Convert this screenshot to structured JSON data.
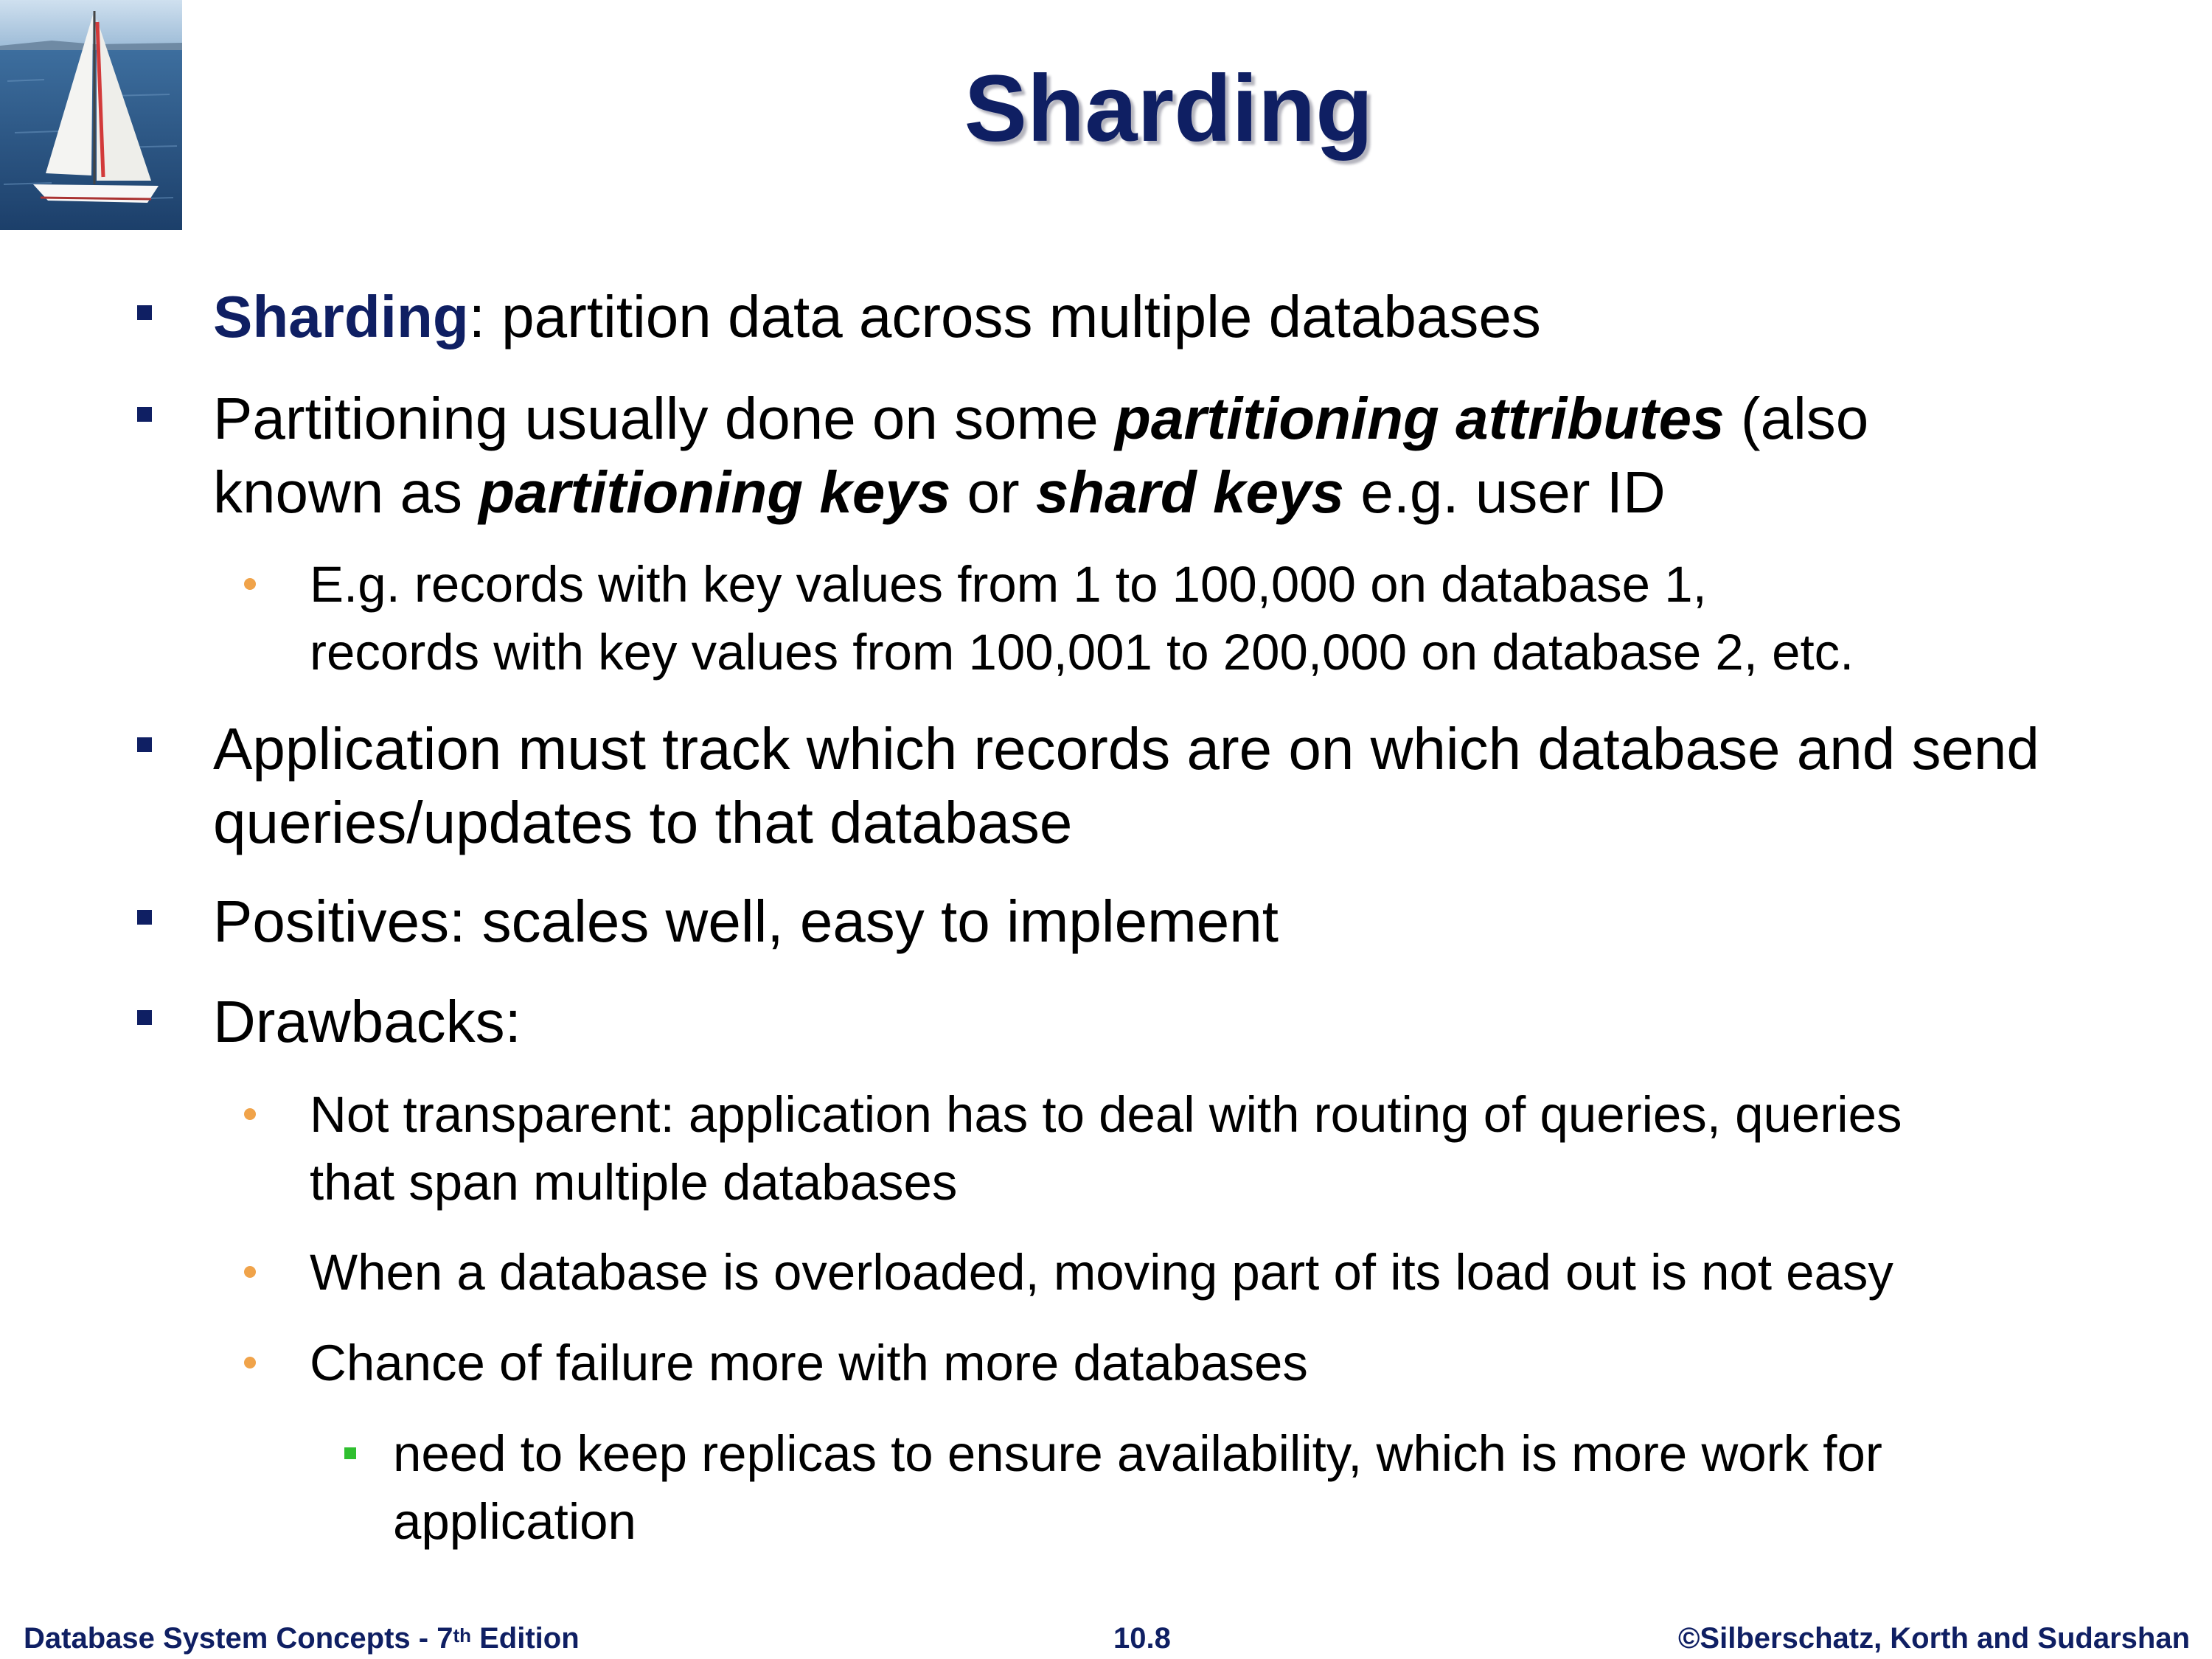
{
  "slide": {
    "title": "Sharding",
    "bullets": [
      {
        "level": 1,
        "parts": [
          {
            "text": "Sharding",
            "style": "blue-bold"
          },
          {
            "text": ": partition data across multiple databases"
          }
        ]
      },
      {
        "level": 1,
        "line1": [
          {
            "text": "Partitioning usually done on some "
          },
          {
            "text": "partitioning attributes",
            "style": "bold-italic"
          },
          {
            "text": " (also"
          }
        ],
        "line2": [
          {
            "text": "known as "
          },
          {
            "text": "partitioning keys",
            "style": "bold-italic"
          },
          {
            "text": " or "
          },
          {
            "text": "shard keys",
            "style": "bold-italic"
          },
          {
            "text": " e.g. user ID"
          }
        ]
      },
      {
        "level": 2,
        "line1": "E.g. records with key values from 1 to 100,000 on database 1,",
        "line2": "records with key values from 100,001 to 200,000 on database 2, etc."
      },
      {
        "level": 1,
        "line1": "Application must track which records are on which database and send",
        "line2": "queries/updates to that database"
      },
      {
        "level": 1,
        "line1": "Positives: scales well, easy to implement"
      },
      {
        "level": 1,
        "line1": "Drawbacks:"
      },
      {
        "level": 2,
        "line1": "Not transparent: application has to deal with routing of queries, queries",
        "line2": "that span multiple databases"
      },
      {
        "level": 2,
        "line1": "When a database is overloaded, moving part of its load out is not easy"
      },
      {
        "level": 2,
        "line1": "Chance of failure more with more databases"
      },
      {
        "level": 3,
        "line1": "need to keep replicas to ensure availability, which is more work for",
        "line2": "application"
      }
    ]
  },
  "footer": {
    "book_prefix": "Database System Concepts - 7",
    "book_sup": "th",
    "book_suffix": " Edition",
    "page": "10.8",
    "copyright": "©Silberschatz, Korth and Sudarshan"
  },
  "logo": {
    "icon": "sailboat-image"
  },
  "colors": {
    "title": "#0f1f63",
    "level1_marker": "#0f1f63",
    "level2_marker": "#f0a34a",
    "level3_marker": "#2fbf2f",
    "keyword": "#0f1f63"
  }
}
